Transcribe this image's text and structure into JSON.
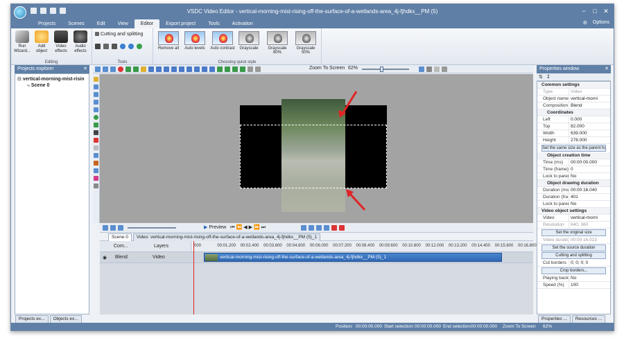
{
  "window": {
    "title": "VSDC Video Editor - vertical-morning-mist-rising-off-the-surface-of-a-wetlands-area_4j-fjhdkx__PM (5)",
    "controls": [
      "−",
      "□",
      "✕"
    ]
  },
  "menu": {
    "items": [
      "Projects",
      "Scenes",
      "Edit",
      "View",
      "Editor",
      "Export project",
      "Tools",
      "Activation"
    ],
    "active": "Editor",
    "options_label": "Options"
  },
  "ribbon": {
    "editing": {
      "label": "Editing",
      "buttons": [
        {
          "label": "Run\nWizard...",
          "icon": "wand-icon"
        },
        {
          "label": "Add\nobject",
          "icon": "add-object-icon"
        },
        {
          "label": "Video\neffects",
          "icon": "film-icon"
        },
        {
          "label": "Audio\neffects",
          "icon": "headphones-icon"
        }
      ]
    },
    "tools": {
      "label": "Tools",
      "title": "Cutting and splitting"
    },
    "quick_style": {
      "label": "Choosing quick style",
      "items": [
        "Remove all",
        "Auto levels",
        "Auto contrast",
        "Grayscale",
        "Grayscale 80%",
        "Grayscale 50%"
      ]
    }
  },
  "projects": {
    "header": "Projects explorer",
    "project_name": "vertical-morning-mist-risin",
    "scene": "Scene 0",
    "tabs": [
      "Projects ex...",
      "Objects ex..."
    ]
  },
  "editor_toolbar": {
    "zoom_label": "Zoom To Screen",
    "zoom_value": "62%"
  },
  "timeline": {
    "preview_label": "Preview",
    "tabs": [
      "Scene 0",
      "Video: vertical-morning-mist-rising-off-the-surface-of-a-wetlands-area_4j-fjhdkx__PM (5)_1"
    ],
    "header_labels": {
      "com": "Com...",
      "layers": "Layers"
    },
    "ruler": [
      "000",
      "00:01.200",
      "00:02.400",
      "00:03.600",
      "00:04.800",
      "00:06.000",
      "00:07.200",
      "00:08.400",
      "00:09.600",
      "00:10.800",
      "00:12.000",
      "00:13.200",
      "00:14.400",
      "00:15.600",
      "00:16.800"
    ],
    "track": {
      "blend": "Blend",
      "type": "Video"
    },
    "clip_label": "vertical-morning-mist-rising-off-the-surface-of-a-wetlands-area_4j-fjhdkx__PM (5)_1"
  },
  "properties": {
    "header": "Properties window",
    "rows": [
      {
        "kind": "sec",
        "label": "Common settings"
      },
      {
        "kind": "row",
        "k": "Type",
        "v": "Video",
        "dis": true
      },
      {
        "kind": "row",
        "k": "Object name",
        "v": "vertical-morni"
      },
      {
        "kind": "row",
        "k": "Composition m",
        "v": "Blend"
      },
      {
        "kind": "sub",
        "label": "Coordinates"
      },
      {
        "kind": "row",
        "k": "Left",
        "v": "0.000"
      },
      {
        "kind": "row",
        "k": "Top",
        "v": "82.000"
      },
      {
        "kind": "row",
        "k": "Width",
        "v": "639.000"
      },
      {
        "kind": "row",
        "k": "Height",
        "v": "278.000"
      },
      {
        "kind": "btn",
        "label": "Set the same size as the parent has"
      },
      {
        "kind": "sub",
        "label": "Object creation time"
      },
      {
        "kind": "row",
        "k": "Time (ms)",
        "v": "00:00:00.000"
      },
      {
        "kind": "row",
        "k": "Time (frame)",
        "v": "0"
      },
      {
        "kind": "row",
        "k": "Lock to parer",
        "v": "No"
      },
      {
        "kind": "sub",
        "label": "Object drawing duration"
      },
      {
        "kind": "row",
        "k": "Duration (ms",
        "v": "00:00:16.040"
      },
      {
        "kind": "row",
        "k": "Duration (fra",
        "v": "401"
      },
      {
        "kind": "row",
        "k": "Lock to parer",
        "v": "No"
      },
      {
        "kind": "sec",
        "label": "Video object settings"
      },
      {
        "kind": "row",
        "k": "Video",
        "v": "vertical-morni"
      },
      {
        "kind": "row",
        "k": "Resolution",
        "v": "640; 360",
        "dis": true
      },
      {
        "kind": "btn",
        "label": "Set the original size"
      },
      {
        "kind": "row",
        "k": "Video duration",
        "v": "00:00:16.023",
        "dis": true
      },
      {
        "kind": "btn",
        "label": "Set the source duration"
      },
      {
        "kind": "btn",
        "label": "Cutting and splitting"
      },
      {
        "kind": "row",
        "k": "Cut borders",
        "v": "0; 0; 0; 0"
      },
      {
        "kind": "btn",
        "label": "Crop borders..."
      },
      {
        "kind": "row",
        "k": "Playing backwa",
        "v": "No"
      },
      {
        "kind": "row",
        "k": "Speed (%)",
        "v": "100"
      }
    ],
    "tabs": [
      "Properties ...",
      "Resources ..."
    ]
  },
  "status": {
    "position_label": "Position:",
    "position": "00:00:00.000",
    "start_label": "Start selection:",
    "start": "00:00:00.000",
    "end_label": "End selection:",
    "end": "00:00:00.000",
    "zoom_label": "Zoom To Screen",
    "zoom": "62%"
  },
  "colors": {
    "titlebar": "#5f7fa6",
    "clip": "#3a76c2",
    "arrow": "#e02424"
  }
}
